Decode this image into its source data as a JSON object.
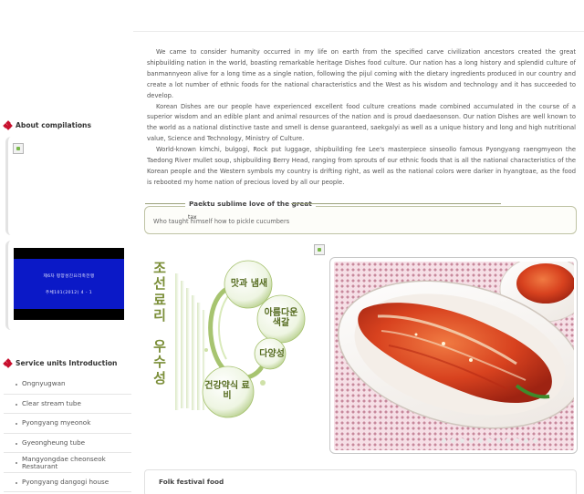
{
  "sidebar": {
    "about_heading": "About compilations",
    "video_caption_1": "제6차 평양성진요리축전랭",
    "video_caption_2": "주체101(2012) 4 - 1",
    "service_heading": "Service units Introduction",
    "service_units": [
      "Ongnyugwan",
      "Clear stream tube",
      "Pyongyang myeonok",
      "Gyeongheung tube",
      "Mangyongdae cheonseok Restaurant",
      "Pyongyang dangogi house"
    ]
  },
  "intro": {
    "paragraphs": [
      "We came to consider humanity occurred in my life on earth from the specified carve civilization ancestors created the great shipbuilding nation in the world, boasting remarkable heritage Dishes food culture. Our nation has a long history and splendid culture of banmannyeon alive for a long time as a single nation, following the pijul coming with the dietary ingredients produced in our country and create a lot number of ethnic foods for the national characteristics and the West as his wisdom and technology and it has succeeded to develop.",
      "Korean Dishes are our people have experienced excellent food culture creations made combined accumulated in the course of a superior wisdom and an edible plant and animal resources of the nation and is proud daedaesonson. Our nation Dishes are well known to the world as a national distinctive taste and smell is dense guaranteed, saekgalyi as well as a unique history and long and high nutritional value, Science and Technology, Ministry of Culture.",
      "World-known kimchi, bulgogi, Rock put luggage, shipbuilding fee Lee's masterpiece sinseollo famous Pyongyang raengmyeon the Taedong River mullet soup, shipbuilding Berry Head, ranging from sprouts of our ethnic foods that is all the national characteristics of the Korean people and the Western symbols my country is drifting right, as well as the national colors were darker in hyangtoae, as the food is rebooted my home nation of precious loved by all our people."
    ]
  },
  "featured": {
    "title": "Paektu sublime love of the great",
    "tag": "tax",
    "text": "Who taught himself how to pickle cucumbers"
  },
  "promo": {
    "vertical_title": [
      "조",
      "선",
      "료",
      "리",
      "",
      "우",
      "수",
      "성"
    ],
    "phrases": [
      "맛과 냄새",
      "아름다운 색갈",
      "다양성",
      "건강약식 료비"
    ]
  },
  "photo": {
    "slide_count": 11
  },
  "festival": {
    "title": "Folk festival food"
  }
}
